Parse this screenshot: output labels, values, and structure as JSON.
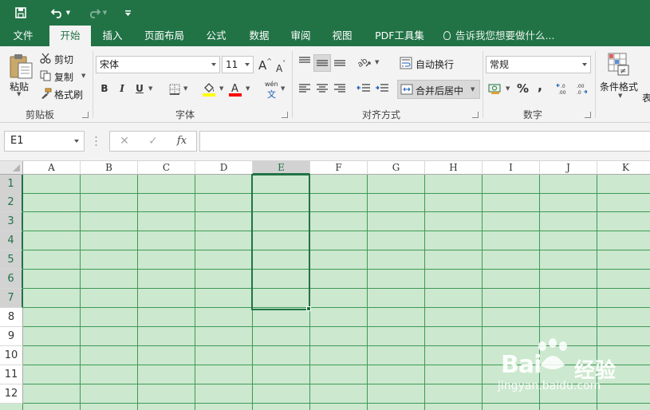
{
  "quick_access": {
    "save_icon": "save-icon",
    "undo_icon": "undo-icon",
    "redo_icon": "redo-icon",
    "customize_icon": "customize-qat-icon"
  },
  "tabs": [
    {
      "label": "文件",
      "active": false
    },
    {
      "label": "开始",
      "active": true
    },
    {
      "label": "插入",
      "active": false
    },
    {
      "label": "页面布局",
      "active": false
    },
    {
      "label": "公式",
      "active": false
    },
    {
      "label": "数据",
      "active": false
    },
    {
      "label": "审阅",
      "active": false
    },
    {
      "label": "视图",
      "active": false
    },
    {
      "label": "PDF工具集",
      "active": false
    }
  ],
  "tell_me": "告诉我您想要做什么...",
  "clipboard": {
    "paste": "粘贴",
    "cut": "剪切",
    "copy": "复制",
    "format_painter": "格式刷",
    "group": "剪贴板"
  },
  "font": {
    "name": "宋体",
    "size": "11",
    "grow": "A",
    "shrink": "A",
    "bold": "B",
    "italic": "I",
    "underline": "U",
    "phonetic_top": "wén",
    "phonetic_bottom": "文",
    "group": "字体"
  },
  "alignment": {
    "wrap_text": "自动换行",
    "merge_center": "合并后居中",
    "group": "对齐方式"
  },
  "number": {
    "format": "常规",
    "percent": "%",
    "comma": ",",
    "group": "数字"
  },
  "styles": {
    "conditional": "条件格式",
    "next_partial": "表"
  },
  "formula_bar": {
    "name_box": "E1",
    "cancel": "✕",
    "enter": "✓",
    "fx": "fx",
    "formula": ""
  },
  "sheet": {
    "columns": [
      "A",
      "B",
      "C",
      "D",
      "E",
      "F",
      "G",
      "H",
      "I",
      "J",
      "K"
    ],
    "rows": [
      "1",
      "2",
      "3",
      "4",
      "5",
      "6",
      "7",
      "8",
      "9",
      "10",
      "11",
      "12"
    ],
    "selected_column": "E",
    "selected_rows": [
      "1",
      "2",
      "3",
      "4",
      "5",
      "6",
      "7"
    ],
    "gridline_color": "#3e9a55",
    "cell_fill": "#cce8cf"
  },
  "watermark": {
    "brand": "Bai",
    "brand_cn": "经验",
    "url": "jingyan.baidu.com"
  },
  "colors": {
    "accent": "#217346",
    "highlight": "#ffff00",
    "font_color": "#ff0000"
  }
}
